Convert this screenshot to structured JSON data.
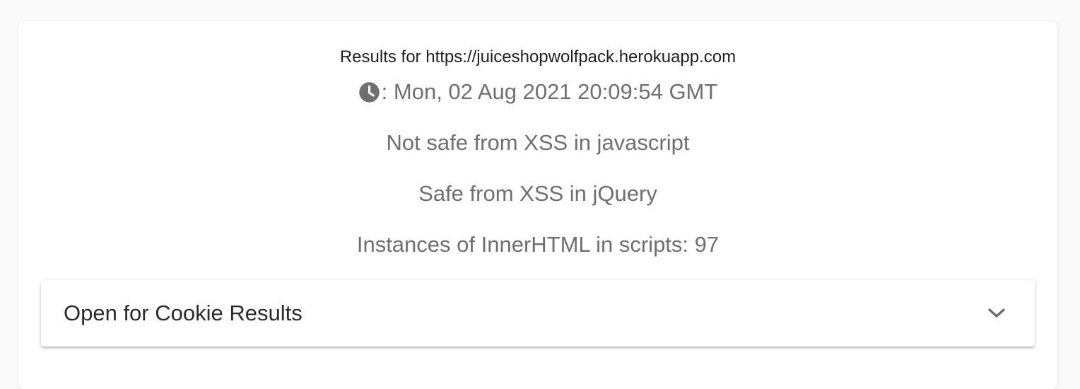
{
  "results": {
    "title": "Results for https://juiceshopwolfpack.herokuapp.com",
    "timestamp": ": Mon, 02 Aug 2021 20:09:54 GMT",
    "timestamp_icon": "clock-icon",
    "lines": [
      "Not safe from XSS in javascript",
      "Safe from XSS in jQuery",
      "Instances of InnerHTML in scripts: 97"
    ]
  },
  "cookie_panel": {
    "title": "Open for Cookie Results",
    "icon": "chevron-down-icon"
  }
}
